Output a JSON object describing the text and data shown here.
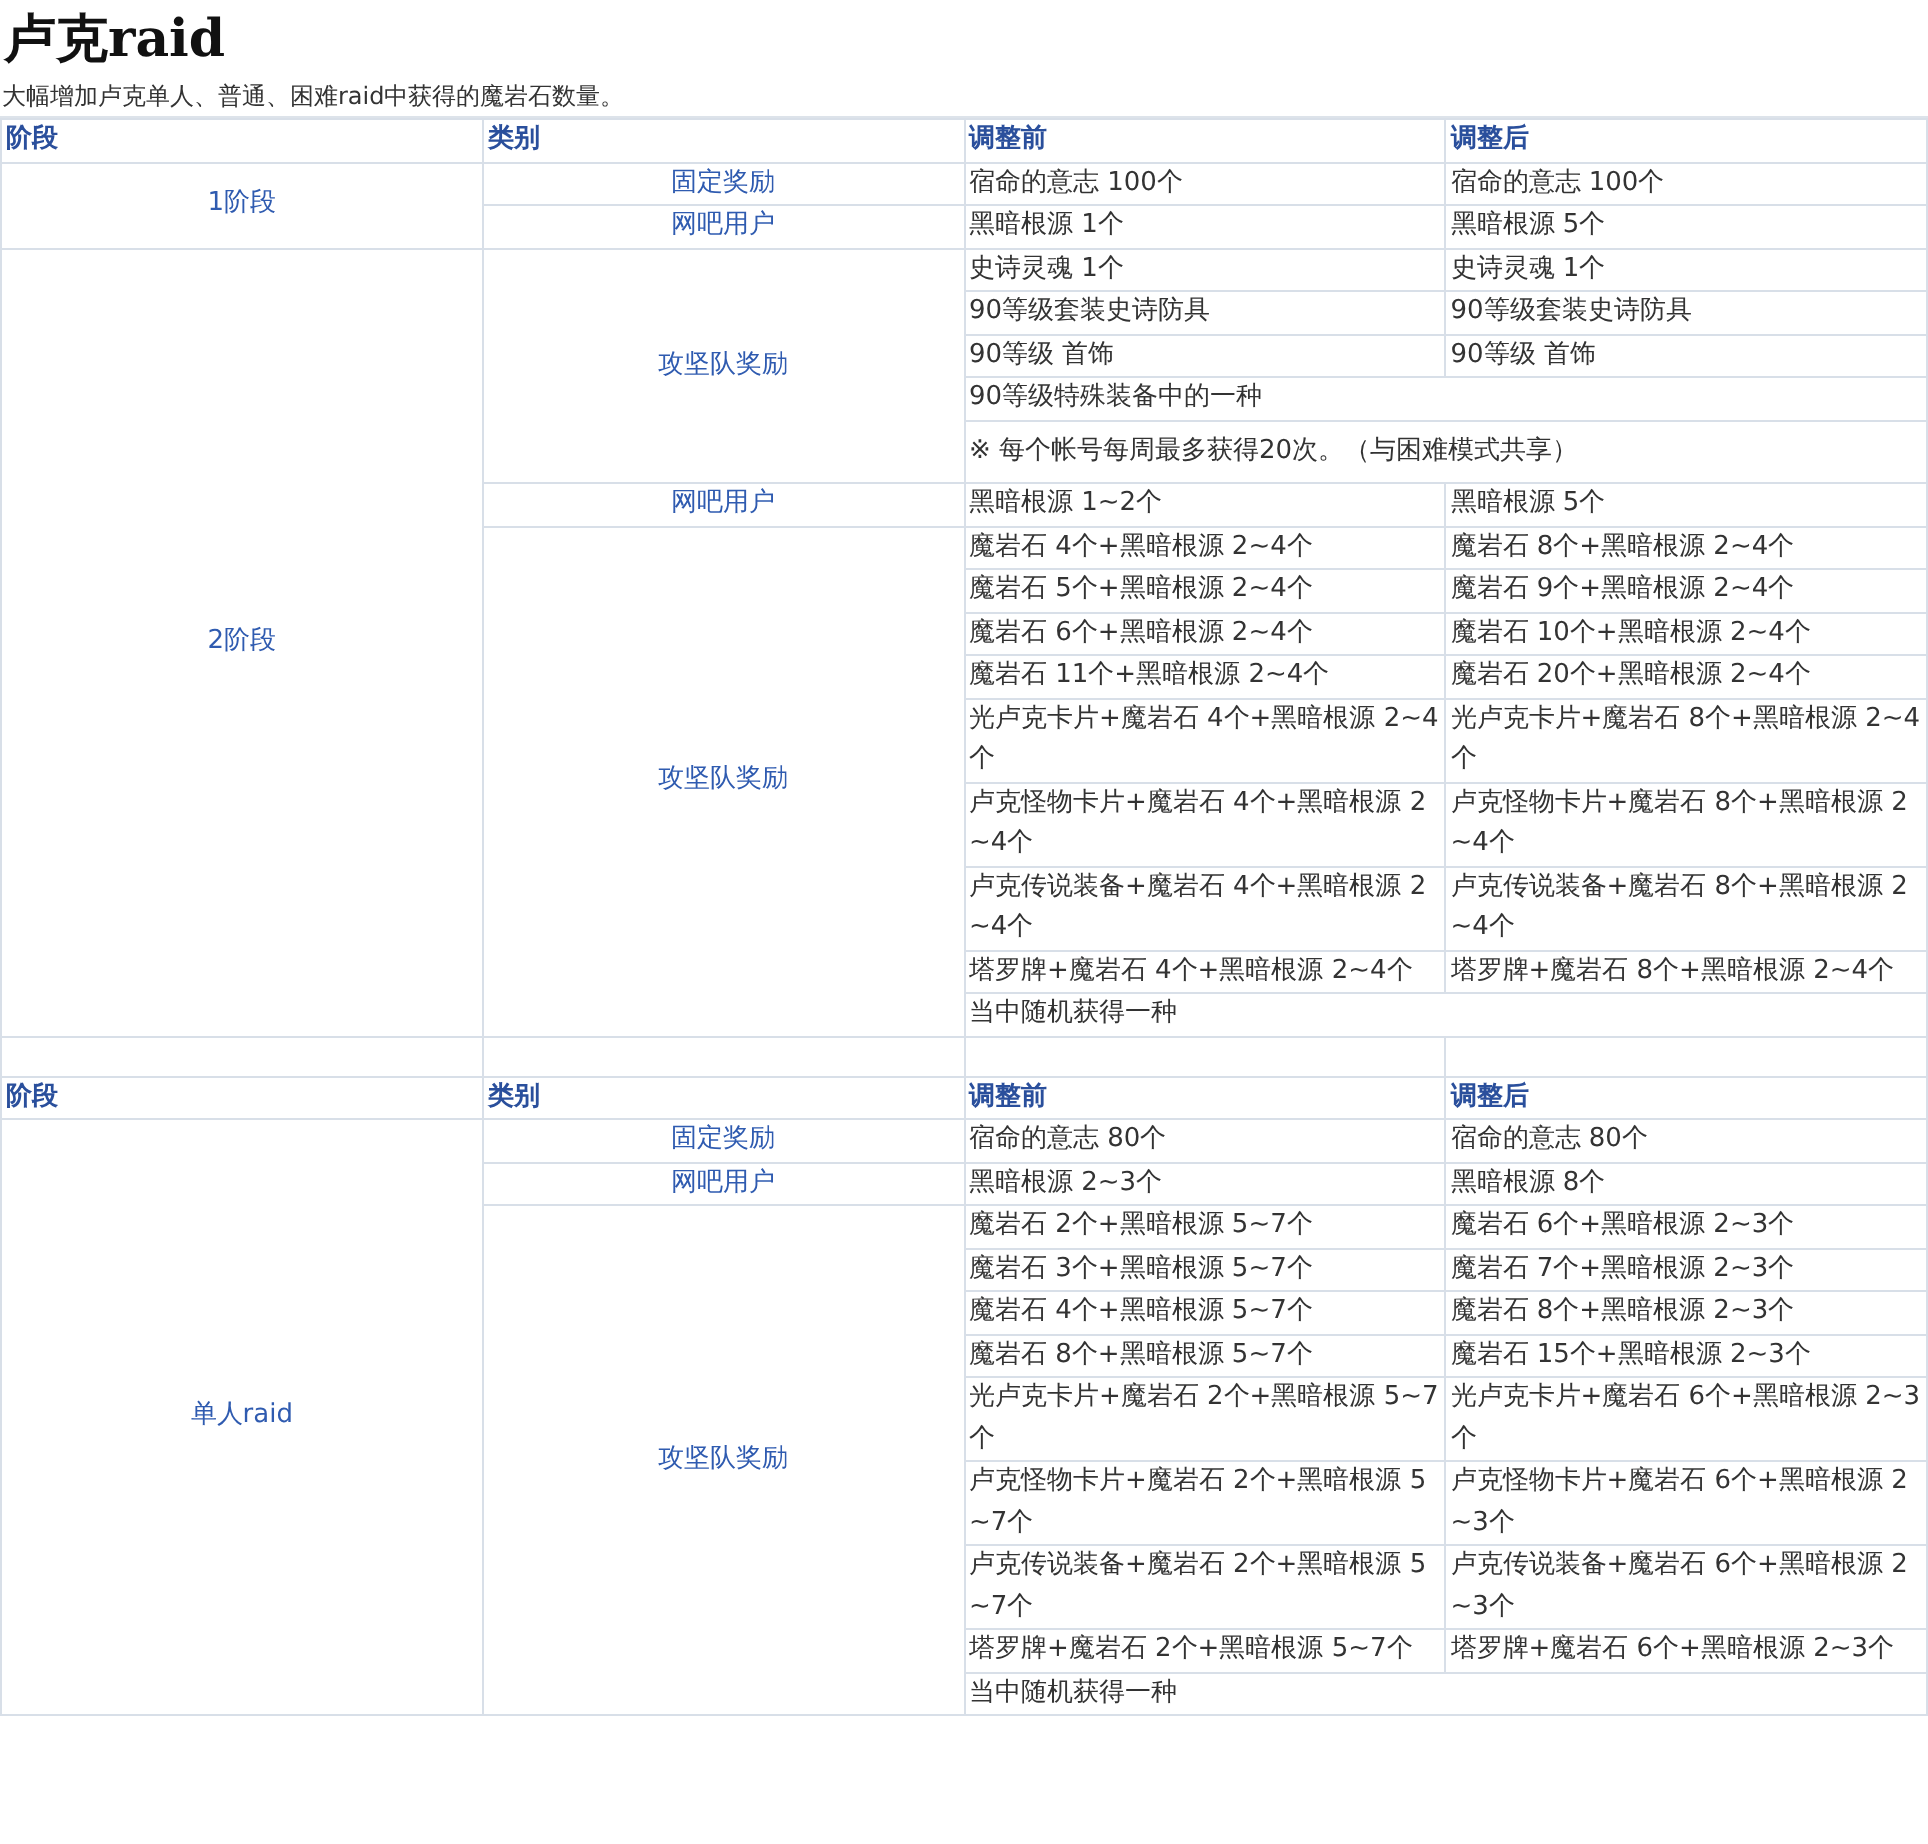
{
  "title": "卢克raid",
  "description": "大幅增加卢克单人、普通、困难raid中获得的魔岩石数量。",
  "sections": [
    {
      "header": [
        "阶段",
        "类别",
        "调整前",
        "调整后"
      ],
      "stages": [
        {
          "stage": "1阶段",
          "groups": [
            {
              "category": "固定奖励",
              "rows": [
                {
                  "kind": "pair",
                  "before": "宿命的意志 100个",
                  "after": "宿命的意志 100个"
                }
              ]
            },
            {
              "category": "网吧用户",
              "rows": [
                {
                  "kind": "pair",
                  "before": "黑暗根源 1个",
                  "after": "黑暗根源 5个"
                }
              ]
            }
          ]
        },
        {
          "stage": "2阶段",
          "groups": [
            {
              "category": "攻坚队奖励",
              "rows": [
                {
                  "kind": "pair",
                  "before": "史诗灵魂 1个",
                  "after": "史诗灵魂 1个"
                },
                {
                  "kind": "pair",
                  "before": "90等级套装史诗防具",
                  "after": "90等级套装史诗防具"
                },
                {
                  "kind": "pair",
                  "before": "90等级 首饰",
                  "after": "90等级 首饰"
                },
                {
                  "kind": "merged",
                  "text": "90等级特殊装备中的一种"
                },
                {
                  "kind": "note",
                  "text": "※ 每个帐号每周最多获得20次。（与困难模式共享）"
                }
              ]
            },
            {
              "category": "网吧用户",
              "rows": [
                {
                  "kind": "pair",
                  "before": "黑暗根源 1~2个",
                  "after": "黑暗根源 5个"
                }
              ]
            },
            {
              "category": "攻坚队奖励",
              "rows": [
                {
                  "kind": "pair",
                  "before": "魔岩石 4个+黑暗根源 2~4个",
                  "after": "魔岩石 8个+黑暗根源 2~4个"
                },
                {
                  "kind": "pair",
                  "before": "魔岩石 5个+黑暗根源 2~4个",
                  "after": "魔岩石 9个+黑暗根源 2~4个"
                },
                {
                  "kind": "pair",
                  "before": "魔岩石 6个+黑暗根源 2~4个",
                  "after": "魔岩石 10个+黑暗根源 2~4个"
                },
                {
                  "kind": "pair",
                  "before": "魔岩石 11个+黑暗根源 2~4个",
                  "after": "魔岩石 20个+黑暗根源 2~4个"
                },
                {
                  "kind": "pair",
                  "before": "光卢克卡片+魔岩石 4个+黑暗根源 2~4个",
                  "after": "光卢克卡片+魔岩石 8个+黑暗根源 2~4个"
                },
                {
                  "kind": "pair",
                  "before": "卢克怪物卡片+魔岩石 4个+黑暗根源 2~4个",
                  "after": "卢克怪物卡片+魔岩石 8个+黑暗根源 2~4个"
                },
                {
                  "kind": "pair",
                  "before": "卢克传说装备+魔岩石 4个+黑暗根源 2~4个",
                  "after": "卢克传说装备+魔岩石 8个+黑暗根源 2~4个"
                },
                {
                  "kind": "pair",
                  "before": "塔罗牌+魔岩石 4个+黑暗根源 2~4个",
                  "after": "塔罗牌+魔岩石 8个+黑暗根源 2~4个"
                },
                {
                  "kind": "merged",
                  "text": "当中随机获得一种"
                }
              ]
            }
          ]
        }
      ]
    },
    {
      "header": [
        "阶段",
        "类别",
        "调整前",
        "调整后"
      ],
      "stages": [
        {
          "stage": "单人raid",
          "groups": [
            {
              "category": "固定奖励",
              "rows": [
                {
                  "kind": "pair",
                  "before": "宿命的意志 80个",
                  "after": "宿命的意志 80个"
                }
              ]
            },
            {
              "category": "网吧用户",
              "rows": [
                {
                  "kind": "pair",
                  "before": "黑暗根源 2~3个",
                  "after": "黑暗根源 8个"
                }
              ]
            },
            {
              "category": "攻坚队奖励",
              "rows": [
                {
                  "kind": "pair",
                  "before": "魔岩石 2个+黑暗根源 5~7个",
                  "after": "魔岩石 6个+黑暗根源 2~3个"
                },
                {
                  "kind": "pair",
                  "before": "魔岩石 3个+黑暗根源 5~7个",
                  "after": "魔岩石 7个+黑暗根源 2~3个"
                },
                {
                  "kind": "pair",
                  "before": "魔岩石 4个+黑暗根源 5~7个",
                  "after": "魔岩石 8个+黑暗根源 2~3个"
                },
                {
                  "kind": "pair",
                  "before": "魔岩石 8个+黑暗根源 5~7个",
                  "after": "魔岩石 15个+黑暗根源 2~3个"
                },
                {
                  "kind": "pair",
                  "before": "光卢克卡片+魔岩石 2个+黑暗根源 5~7个",
                  "after": "光卢克卡片+魔岩石 6个+黑暗根源 2~3个"
                },
                {
                  "kind": "pair",
                  "before": "卢克怪物卡片+魔岩石 2个+黑暗根源 5~7个",
                  "after": "卢克怪物卡片+魔岩石 6个+黑暗根源 2~3个"
                },
                {
                  "kind": "pair",
                  "before": "卢克传说装备+魔岩石 2个+黑暗根源 5~7个",
                  "after": "卢克传说装备+魔岩石 6个+黑暗根源 2~3个"
                },
                {
                  "kind": "pair",
                  "before": "塔罗牌+魔岩石 2个+黑暗根源 5~7个",
                  "after": "塔罗牌+魔岩石 6个+黑暗根源 2~3个"
                },
                {
                  "kind": "merged",
                  "text": "当中随机获得一种"
                }
              ]
            }
          ]
        }
      ]
    }
  ]
}
